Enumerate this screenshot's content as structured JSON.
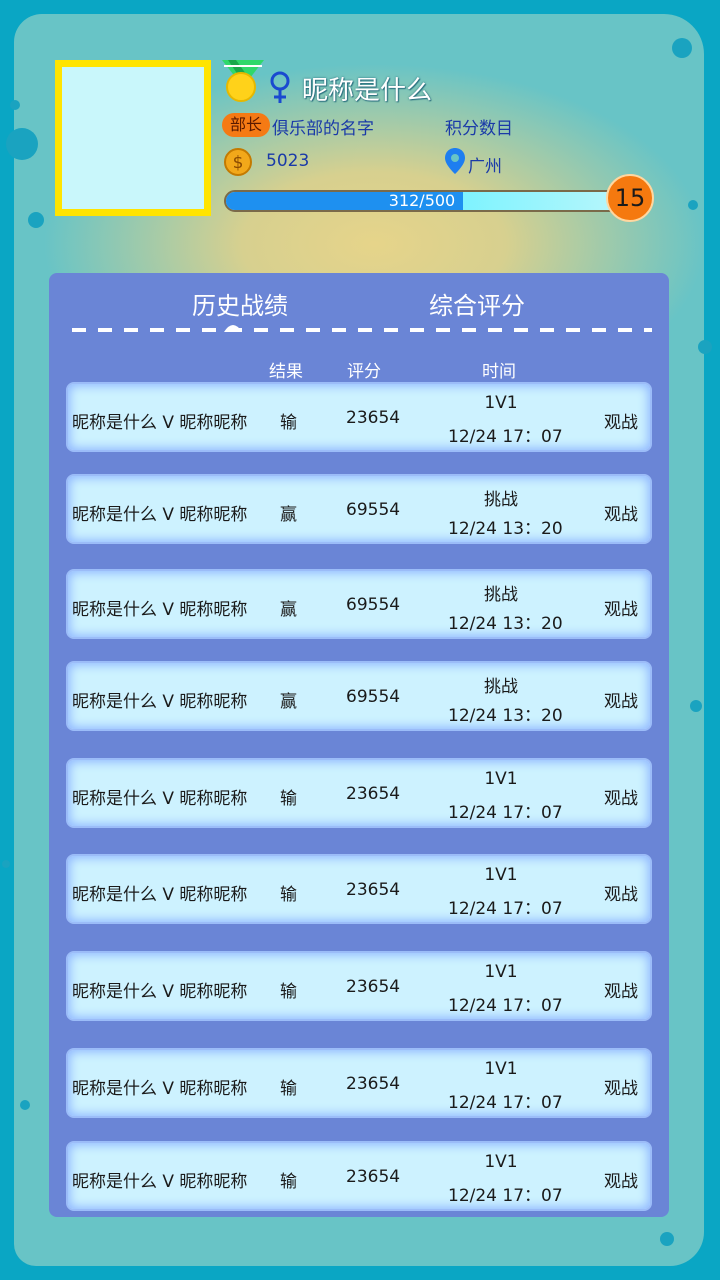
{
  "profile": {
    "nickname": "昵称是什么",
    "role": "部长",
    "club": "俱乐部的名字",
    "points_label": "积分数目",
    "coins": "5023",
    "city": "广州",
    "xp_text": "312/500",
    "xp_progress": 0.624,
    "level": "15",
    "gender": "female"
  },
  "tabs": [
    {
      "label": "历史战绩",
      "active": true
    },
    {
      "label": "综合评分",
      "active": false
    }
  ],
  "columns": {
    "result": "结果",
    "score": "评分",
    "time": "时间"
  },
  "rows": [
    {
      "match": "昵称是什么 V 昵称昵称",
      "result": "输",
      "score": "23654",
      "mode": "1V1",
      "time": "12/24 17：07",
      "watch": "观战"
    },
    {
      "match": "昵称是什么 V 昵称昵称",
      "result": "赢",
      "score": "69554",
      "mode": "挑战",
      "time": "12/24 13：20",
      "watch": "观战"
    },
    {
      "match": "昵称是什么 V 昵称昵称",
      "result": "赢",
      "score": "69554",
      "mode": "挑战",
      "time": "12/24 13：20",
      "watch": "观战"
    },
    {
      "match": "昵称是什么 V 昵称昵称",
      "result": "赢",
      "score": "69554",
      "mode": "挑战",
      "time": "12/24 13：20",
      "watch": "观战"
    },
    {
      "match": "昵称是什么 V 昵称昵称",
      "result": "输",
      "score": "23654",
      "mode": "1V1",
      "time": "12/24 17：07",
      "watch": "观战"
    },
    {
      "match": "昵称是什么 V 昵称昵称",
      "result": "输",
      "score": "23654",
      "mode": "1V1",
      "time": "12/24 17：07",
      "watch": "观战"
    },
    {
      "match": "昵称是什么 V 昵称昵称",
      "result": "输",
      "score": "23654",
      "mode": "1V1",
      "time": "12/24 17：07",
      "watch": "观战"
    },
    {
      "match": "昵称是什么 V 昵称昵称",
      "result": "输",
      "score": "23654",
      "mode": "1V1",
      "time": "12/24 17：07",
      "watch": "观战"
    },
    {
      "match": "昵称是什么 V 昵称昵称",
      "result": "输",
      "score": "23654",
      "mode": "1V1",
      "time": "12/24 17：07",
      "watch": "观战"
    }
  ],
  "colors": {
    "sea": "#0aa6c4",
    "panel": "#6a85d6",
    "row": "#cdf2ff",
    "avatar_border": "#ffe400",
    "level": "#f5790f"
  },
  "icons": {
    "medal": "medal-icon",
    "gender": "female-icon",
    "coin": "coin-icon",
    "location": "location-pin-icon"
  }
}
